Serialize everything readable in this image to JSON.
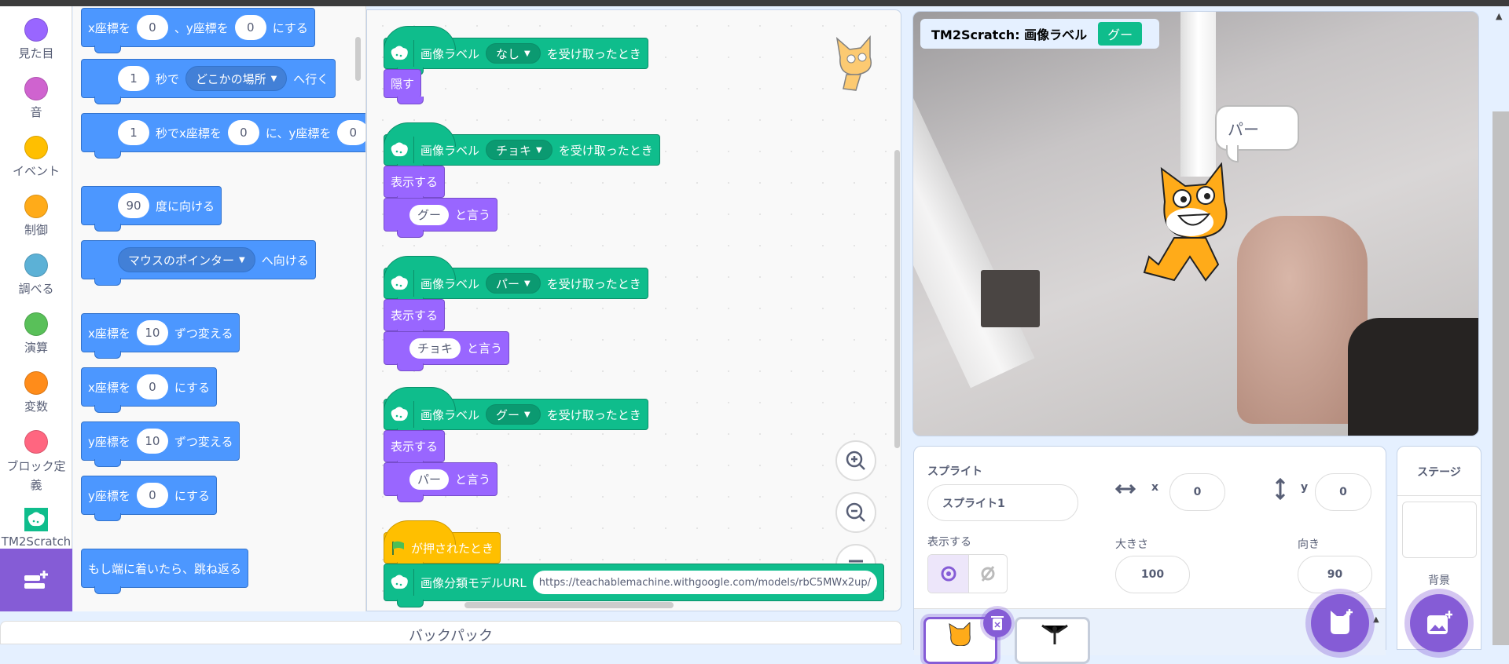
{
  "categories": [
    {
      "label": "見た目",
      "color": "#9966ff"
    },
    {
      "label": "音",
      "color": "#cf63cf"
    },
    {
      "label": "イベント",
      "color": "#ffbf00"
    },
    {
      "label": "制御",
      "color": "#ffab19"
    },
    {
      "label": "調べる",
      "color": "#5cb1d6"
    },
    {
      "label": "演算",
      "color": "#59c059"
    },
    {
      "label": "変数",
      "color": "#ff8c1a"
    },
    {
      "label": "ブロック定義",
      "color": "#ff6680"
    },
    {
      "label": "TM2Scratch",
      "color": "#0fbd8c",
      "icon": "tm2scratch-icon"
    }
  ],
  "extension_button": {
    "icon": "add-extension-icon"
  },
  "palette": [
    [
      {
        "t": "x座標を"
      },
      {
        "n": "0"
      },
      {
        "t": "、y座標を"
      },
      {
        "n": "0"
      },
      {
        "t": "にする"
      }
    ],
    [
      {
        "n": "1"
      },
      {
        "t": "秒で"
      },
      {
        "d": "どこかの場所"
      },
      {
        "t": "へ行く"
      }
    ],
    [
      {
        "n": "1"
      },
      {
        "t": "秒でx座標を"
      },
      {
        "n": "0"
      },
      {
        "t": "に、y座標を"
      },
      {
        "n": "0"
      }
    ],
    [
      {
        "n": "90"
      },
      {
        "t": "度に向ける"
      }
    ],
    [
      {
        "d": "マウスのポインター"
      },
      {
        "t": "へ向ける"
      }
    ],
    [
      {
        "t": "x座標を"
      },
      {
        "n": "10"
      },
      {
        "t": "ずつ変える"
      }
    ],
    [
      {
        "t": "x座標を"
      },
      {
        "n": "0"
      },
      {
        "t": "にする"
      }
    ],
    [
      {
        "t": "y座標を"
      },
      {
        "n": "10"
      },
      {
        "t": "ずつ変える"
      }
    ],
    [
      {
        "t": "y座標を"
      },
      {
        "n": "0"
      },
      {
        "t": "にする"
      }
    ],
    [
      {
        "t": "もし端に着いたら、跳ね返る"
      }
    ]
  ],
  "scripts": [
    {
      "hat": {
        "label": "画像ラベル",
        "value": "なし",
        "suffix": "を受け取ったとき"
      },
      "blocks": [
        {
          "type": "looks",
          "parts": [
            {
              "t": "隠す"
            }
          ]
        }
      ]
    },
    {
      "hat": {
        "label": "画像ラベル",
        "value": "チョキ",
        "suffix": "を受け取ったとき"
      },
      "blocks": [
        {
          "type": "looks",
          "parts": [
            {
              "t": "表示する"
            }
          ]
        },
        {
          "type": "looks",
          "parts": [
            {
              "n": "グー"
            },
            {
              "t": "と言う"
            }
          ]
        }
      ]
    },
    {
      "hat": {
        "label": "画像ラベル",
        "value": "パー",
        "suffix": "を受け取ったとき"
      },
      "blocks": [
        {
          "type": "looks",
          "parts": [
            {
              "t": "表示する"
            }
          ]
        },
        {
          "type": "looks",
          "parts": [
            {
              "n": "チョキ"
            },
            {
              "t": "と言う"
            }
          ]
        }
      ]
    },
    {
      "hat": {
        "label": "画像ラベル",
        "value": "グー",
        "suffix": "を受け取ったとき"
      },
      "blocks": [
        {
          "type": "looks",
          "parts": [
            {
              "t": "表示する"
            }
          ]
        },
        {
          "type": "looks",
          "parts": [
            {
              "n": "パー"
            },
            {
              "t": "と言う"
            }
          ]
        }
      ]
    },
    {
      "flag_hat": {
        "label": "が押されたとき"
      },
      "blocks": [
        {
          "type": "tm",
          "parts": [
            {
              "t": "画像分類モデルURL"
            },
            {
              "u": "https://teachablemachine.withgoogle.com/models/rbC5MWx2up/"
            }
          ]
        }
      ]
    }
  ],
  "backpack": {
    "label": "バックパック"
  },
  "stage": {
    "monitor_label": "TM2Scratch: 画像ラベル",
    "monitor_value": "グー",
    "speech": "パー"
  },
  "sprite_info": {
    "sprite_label": "スプライト",
    "name": "スプライト1",
    "x_label": "x",
    "x": "0",
    "y_label": "y",
    "y": "0",
    "show_label": "表示する",
    "size_label": "大きさ",
    "size": "100",
    "direction_label": "向き",
    "direction": "90"
  },
  "stage_pane": {
    "title": "ステージ",
    "backdrops_label": "背景"
  },
  "colors": {
    "motion": "#4c97ff",
    "looks": "#9966ff",
    "tm": "#0fbd8c",
    "event": "#ffbf00",
    "accent": "#855cd6"
  }
}
